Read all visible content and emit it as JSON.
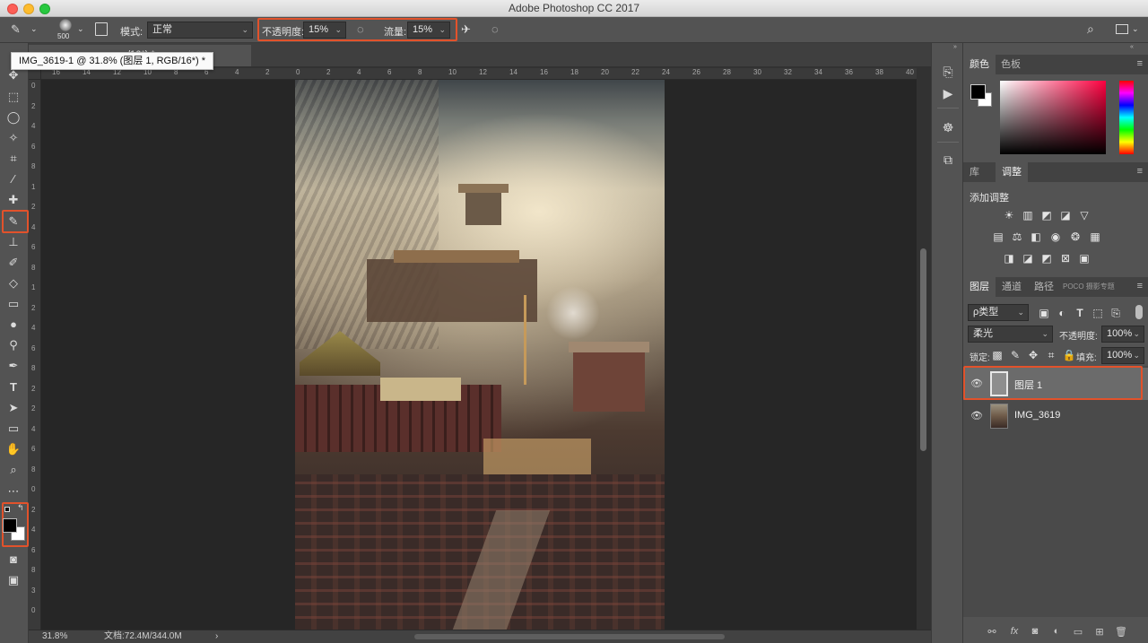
{
  "window": {
    "title": "Adobe Photoshop CC 2017"
  },
  "options": {
    "brush_size": "500",
    "mode_label": "模式:",
    "mode_value": "正常",
    "opacity_label": "不透明度:",
    "opacity_value": "15%",
    "flow_label": "流量:",
    "flow_value": "15%"
  },
  "document": {
    "tab_title": "IMG_3619-1 @ 31.8% (图层 1, RGB/16*) *",
    "tab_tail": "/16*) *",
    "tooltip": "IMG_3619-1 @ 31.8% (图层 1, RGB/16*) *"
  },
  "ruler": {
    "top": [
      "16",
      "14",
      "12",
      "10",
      "8",
      "6",
      "4",
      "2",
      "0",
      "2",
      "4",
      "6",
      "8",
      "10",
      "12",
      "14",
      "16",
      "18",
      "20",
      "22",
      "24",
      "26",
      "28",
      "30",
      "32",
      "34",
      "36",
      "38",
      "40"
    ],
    "left": [
      "0",
      "2",
      "4",
      "6",
      "8",
      "1",
      "2",
      "4",
      "6",
      "8",
      "1",
      "2",
      "4",
      "6",
      "8",
      "2",
      "2",
      "4",
      "6",
      "8",
      "0",
      "2",
      "4",
      "6",
      "8",
      "3",
      "0"
    ]
  },
  "status": {
    "zoom": "31.8%",
    "doc_info": "文档:72.4M/344.0M",
    "arrow": "›"
  },
  "color_panel": {
    "tab_color": "颜色",
    "tab_swatches": "色板"
  },
  "adjust_panel": {
    "tab_library": "库",
    "tab_adjust": "调整",
    "add_label": "添加调整",
    "icons_row1": [
      "brightness-icon",
      "levels-icon",
      "curves-icon",
      "exposure-icon",
      "vibrance-icon"
    ],
    "icons_row2": [
      "hue-saturation-icon",
      "color-balance-icon",
      "black-white-icon",
      "photo-filter-icon",
      "channel-mixer-icon",
      "color-lookup-icon"
    ],
    "icons_row3": [
      "invert-icon",
      "posterize-icon",
      "threshold-icon",
      "selective-color-icon",
      "gradient-map-icon"
    ]
  },
  "layers_panel": {
    "tab_layers": "图层",
    "tab_channels": "通道",
    "tab_paths": "路径",
    "tab_poco": "POCO 摄影专题",
    "filter_label": "ρ类型",
    "blend_mode": "柔光",
    "opacity_label": "不透明度:",
    "opacity_value": "100%",
    "lock_label": "锁定:",
    "fill_label": "填充:",
    "fill_value": "100%",
    "layers": [
      {
        "name": "图层 1",
        "selected": true
      },
      {
        "name": "IMG_3619",
        "selected": false
      }
    ]
  },
  "colors": {
    "highlight": "#e2522b",
    "selected_layer": "#6b6b6b",
    "panel_bg": "#535353"
  }
}
